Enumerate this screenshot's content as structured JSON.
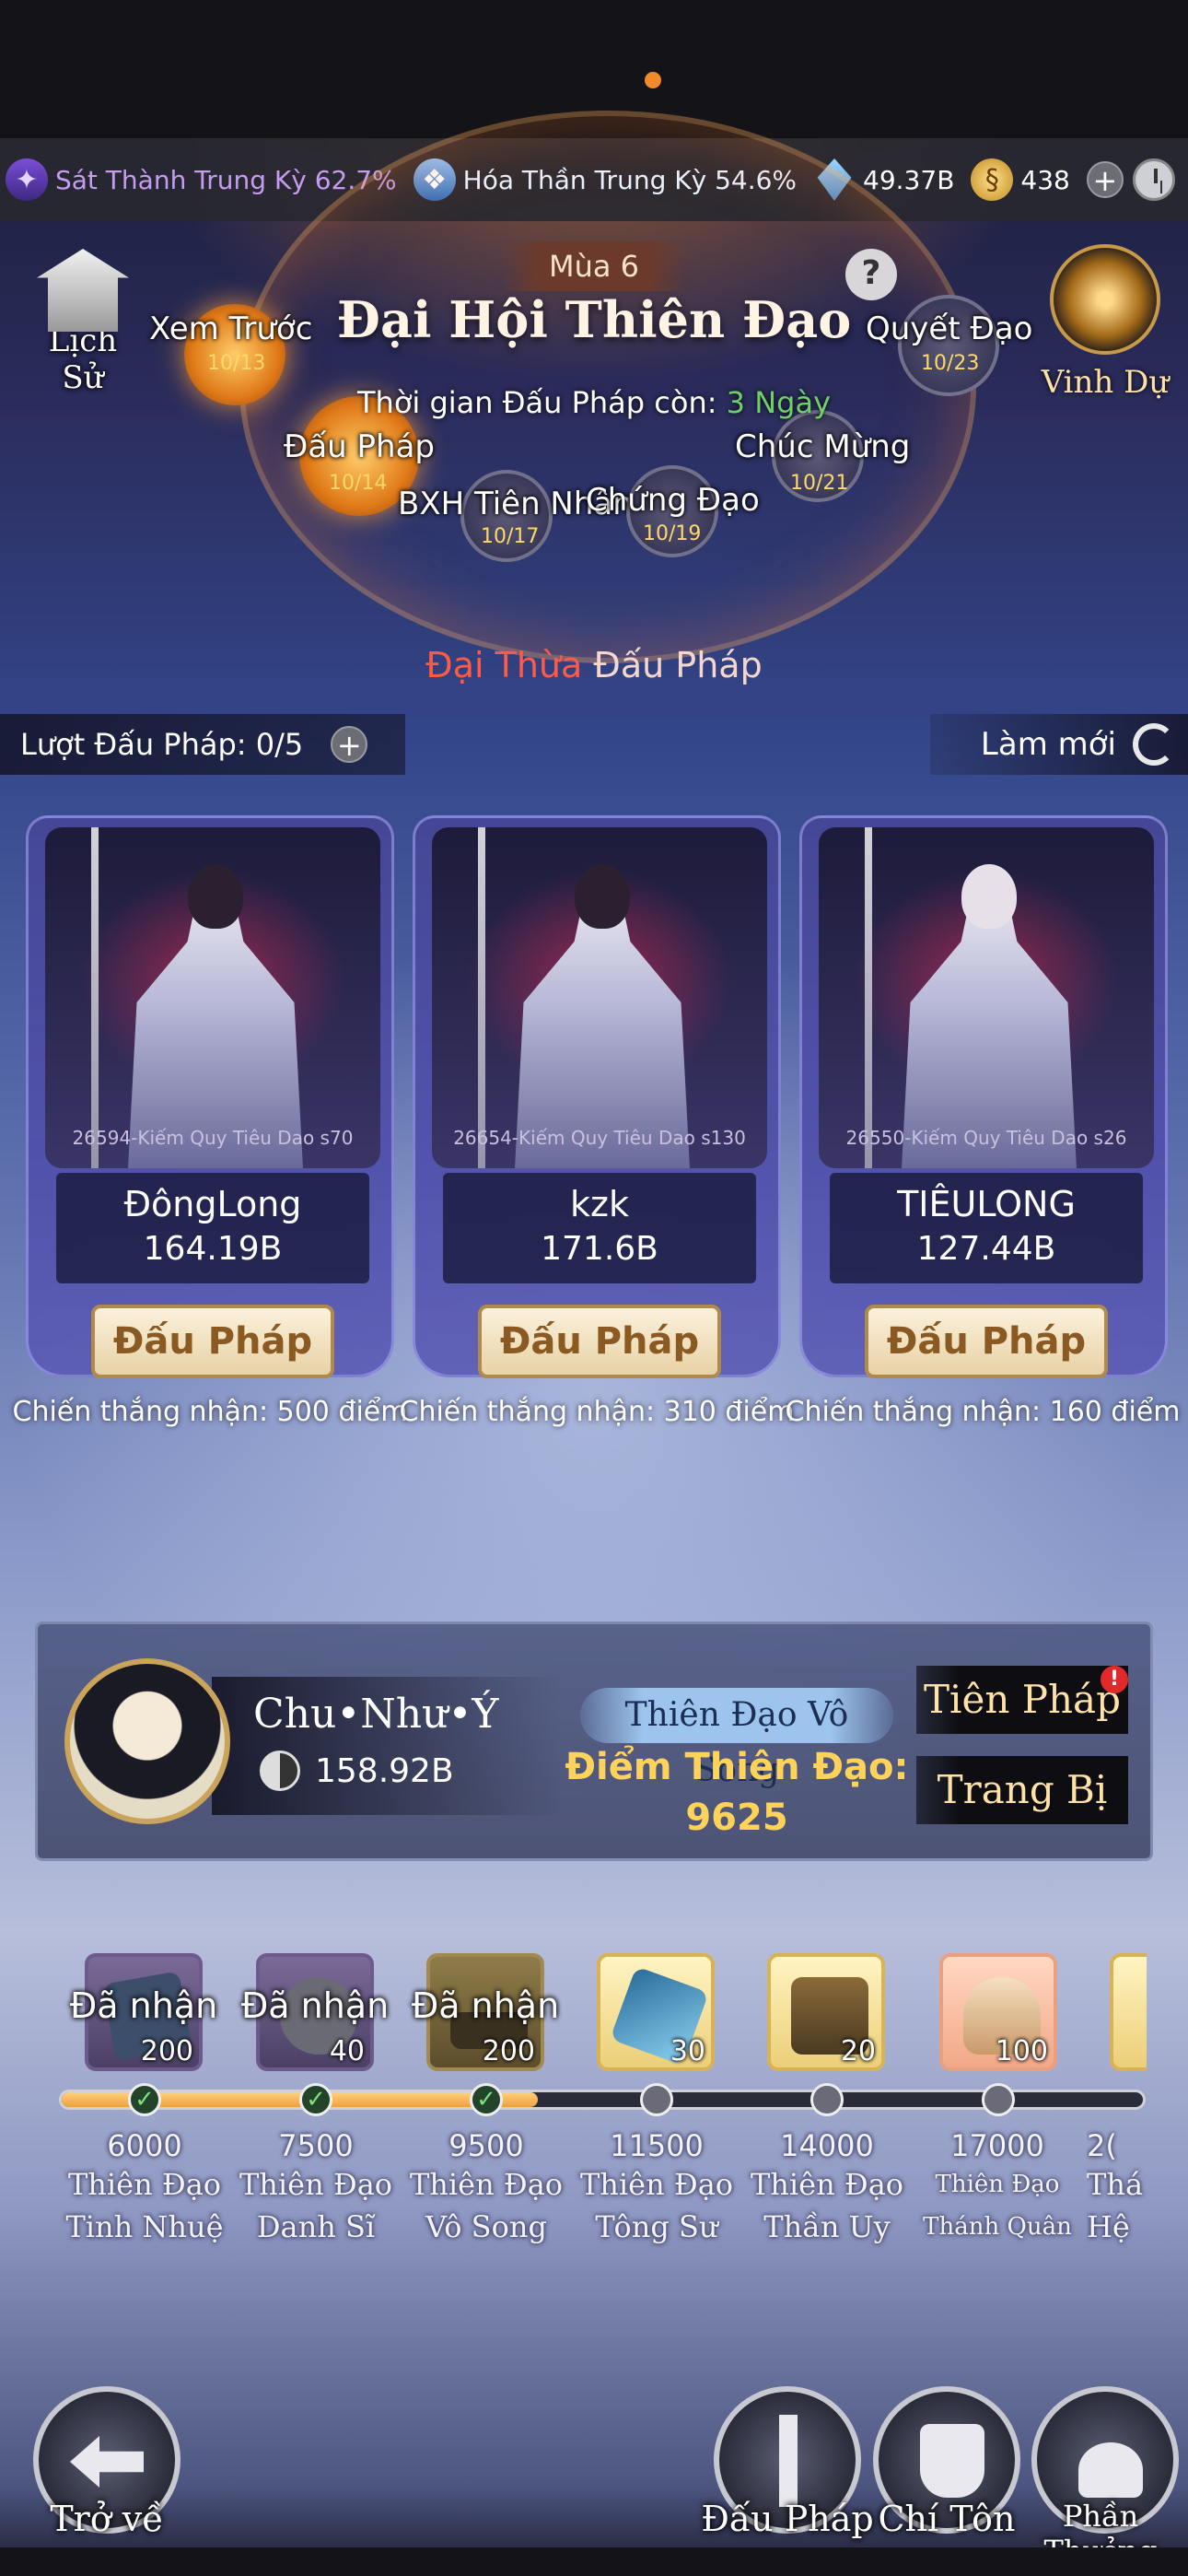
{
  "resources": {
    "rank1": "Sát Thành Trung Kỳ 62.7%",
    "rank2": "Hóa Thần Trung Kỳ 54.6%",
    "gems": "49.37B",
    "coins": "438"
  },
  "header": {
    "season": "Mùa 6",
    "title": "Đại Hội Thiên Đạo",
    "history_label": "Lịch Sử",
    "honor_label": "Vinh Dự",
    "timer_prefix": "Thời gian Đấu Pháp còn: ",
    "timer_value": "3 Ngày"
  },
  "stages": [
    {
      "label": "Xem Trước",
      "date": "10/13"
    },
    {
      "label": "Đấu Pháp",
      "date": "10/14"
    },
    {
      "label": "BXH Tiên Nhân",
      "date": "10/17"
    },
    {
      "label": "Chứng Đạo",
      "date": "10/19"
    },
    {
      "label": "Chúc Mừng",
      "date": "10/21"
    },
    {
      "label": "Quyết Đạo",
      "date": "10/23"
    }
  ],
  "section": {
    "title_red": "Đại Thừa",
    "title_rest": "Đấu Pháp"
  },
  "turns_label": "Lượt Đấu Pháp: 0/5",
  "refresh_label": "Làm mới",
  "opponents": [
    {
      "server": "26594-Kiếm Quy Tiêu Dao s70",
      "name": "ĐôngLong",
      "power": "164.19B",
      "button": "Đấu Pháp",
      "reward": "Chiến thắng nhận: 500 điểm"
    },
    {
      "server": "26654-Kiếm Quy Tiêu Dao s130",
      "name": "kzk",
      "power": "171.6B",
      "button": "Đấu Pháp",
      "reward": "Chiến thắng nhận: 310 điểm"
    },
    {
      "server": "26550-Kiếm Quy Tiêu Dao s26",
      "name": "TIÊULONG",
      "power": "127.44B",
      "button": "Đấu Pháp",
      "reward": "Chiến thắng nhận: 160 điểm"
    }
  ],
  "player": {
    "name": "Chu•Như•Ý",
    "power": "158.92B",
    "rank_title": "Thiên Đạo Vô Song",
    "points_label": "Điểm Thiên Đạo:",
    "points_value": "9625",
    "btn_tien_phap": "Tiên Pháp",
    "badge": "!",
    "btn_trang_bi": "Trang Bị"
  },
  "milestones": {
    "progress": 0.44,
    "claimed_label": "Đã nhận",
    "items": [
      {
        "qty": "200",
        "threshold": "6000",
        "title1": "Thiên Đạo",
        "title2": "Tinh Nhuệ",
        "claimed": true
      },
      {
        "qty": "40",
        "threshold": "7500",
        "title1": "Thiên Đạo",
        "title2": "Danh Sĩ",
        "claimed": true
      },
      {
        "qty": "200",
        "threshold": "9500",
        "title1": "Thiên Đạo",
        "title2": "Vô Song",
        "claimed": true
      },
      {
        "qty": "30",
        "threshold": "11500",
        "title1": "Thiên Đạo",
        "title2": "Tông Sư",
        "claimed": false
      },
      {
        "qty": "20",
        "threshold": "14000",
        "title1": "Thiên Đạo",
        "title2": "Thần Uy",
        "claimed": false
      },
      {
        "qty": "100",
        "threshold": "17000",
        "title1": "Thiên Đạo",
        "title2": "Thánh Quân",
        "claimed": false
      },
      {
        "qty": "",
        "threshold": "2(",
        "title1": "Thá",
        "title2": "Hệ",
        "claimed": false
      }
    ]
  },
  "nav": {
    "back": "Trở về",
    "fight": "Đấu Pháp",
    "supreme": "Chí Tôn",
    "rewards": "Phần Thưởng"
  }
}
